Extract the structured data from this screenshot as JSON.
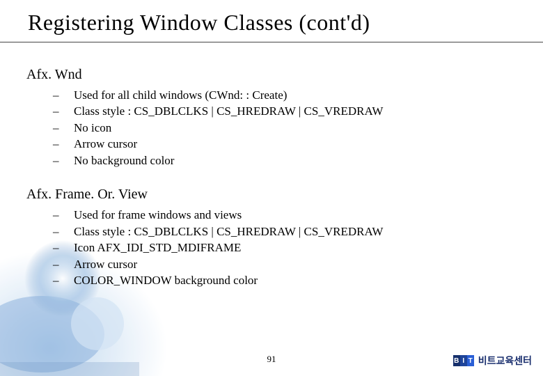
{
  "title": "Registering Window Classes (cont'd)",
  "sections": [
    {
      "heading": "Afx. Wnd",
      "items": [
        "Used for all child windows (CWnd: : Create)",
        "Class style : CS_DBLCLKS | CS_HREDRAW | CS_VREDRAW",
        "No icon",
        "Arrow cursor",
        "No background color"
      ]
    },
    {
      "heading": "Afx. Frame. Or. View",
      "items": [
        "Used for frame windows and views",
        "Class style : CS_DBLCLKS | CS_HREDRAW | CS_VREDRAW",
        "Icon AFX_IDI_STD_MDIFRAME",
        "Arrow cursor",
        "COLOR_WINDOW background color"
      ]
    }
  ],
  "page_number": "91",
  "brand": {
    "logo_letters": [
      "B",
      "I",
      "T"
    ],
    "text": "비트교육센터"
  }
}
